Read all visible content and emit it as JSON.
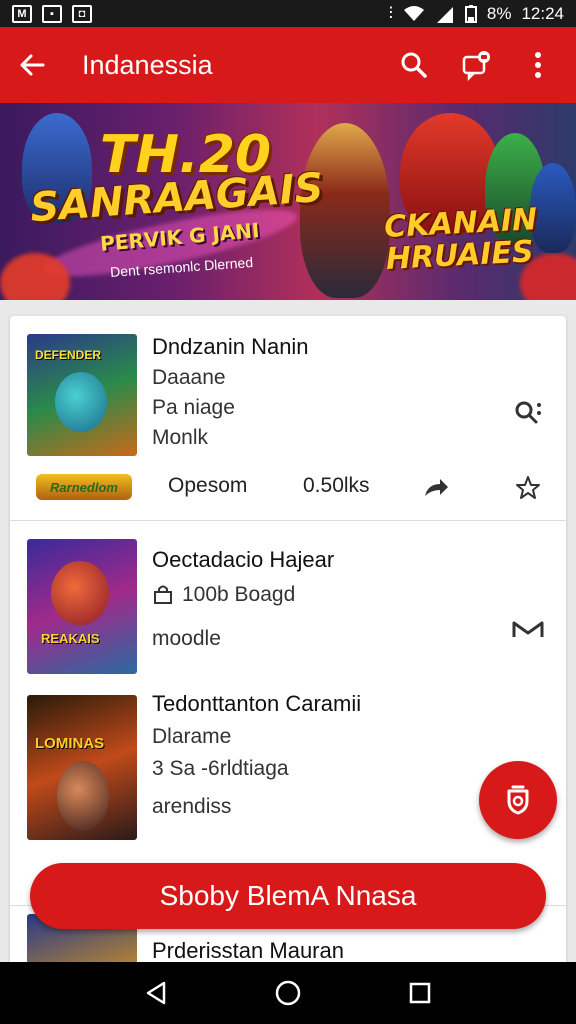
{
  "status_bar": {
    "battery": "8%",
    "time": "12:24"
  },
  "app_bar": {
    "title": "Indanessia"
  },
  "banner": {
    "line1": "TH.20",
    "line2": "SANRAAGAIS",
    "line3": "PERVIK G JANI",
    "line4": "Dent rsemonlc Dlerned",
    "right_title_1": "CKANAIN",
    "right_title_2": "HRUAIES",
    "thumb_caption": ""
  },
  "items": [
    {
      "title": "Dndzanin Nanin",
      "line2": "Daaane",
      "line3": "Pa niage",
      "line4": "Monlk",
      "thumb_text": "DEFENDER",
      "logo_text": "Rarnedlom",
      "meta_1": "Opesom",
      "meta_2": "0.50lks"
    },
    {
      "title": "Oectadacio Hajear",
      "line2": "100b Boagd",
      "line3": "moodle",
      "thumb_text": "REAKAIS"
    },
    {
      "title": "Tedonttanton Caramii",
      "line2": "Dlarame",
      "line3": "3 Sa -6rldtiaga",
      "line4": "arendiss",
      "thumb_text": "LOMINAS"
    },
    {
      "title": "Prderisstan Mauran"
    }
  ],
  "cta": {
    "label": "Sboby BlemA Nnasa"
  },
  "colors": {
    "primary": "#d81919",
    "statusbar": "#1a1a1a",
    "navbar": "#000000"
  }
}
